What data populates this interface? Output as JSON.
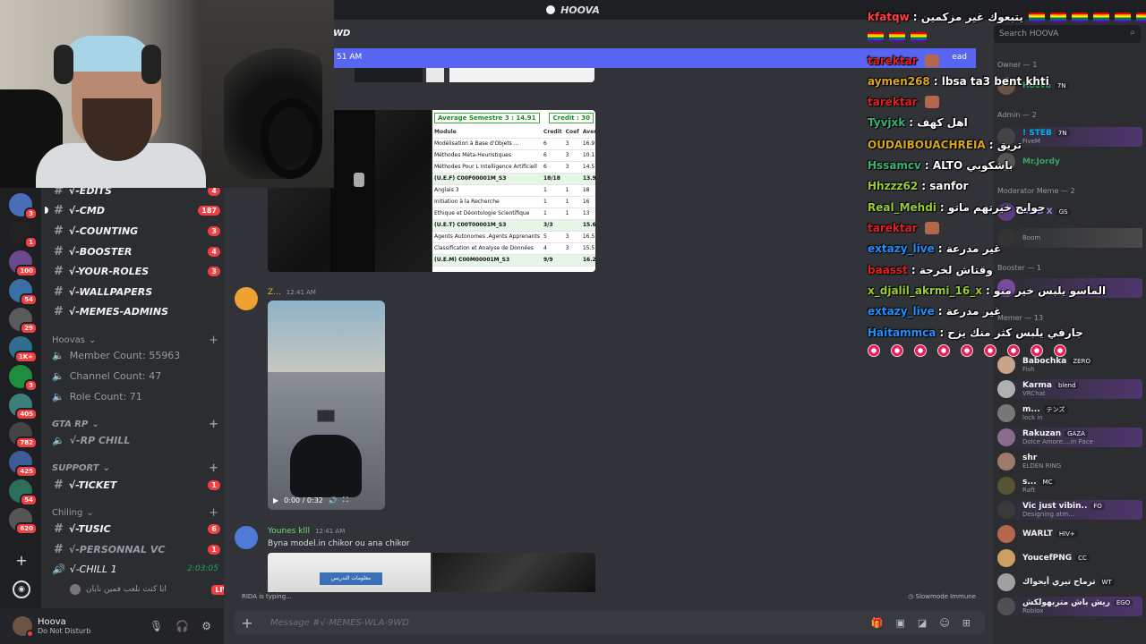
{
  "window": {
    "title": "HOOVA"
  },
  "banner": {
    "time": "51 AM",
    "right": "ead"
  },
  "header": {
    "channel_fragment": "WD"
  },
  "channels": [
    {
      "name": "√-EDITS",
      "badge": "4"
    },
    {
      "name": "√-CMD",
      "badge": "187"
    },
    {
      "name": "√-COUNTING",
      "badge": "3"
    },
    {
      "name": "√-BOOSTER",
      "badge": "4"
    },
    {
      "name": "√-YOUR-ROLES",
      "badge": "3"
    },
    {
      "name": "√-WALLPAPERS",
      "badge": ""
    },
    {
      "name": "√-MEMES-ADMINS",
      "badge": ""
    }
  ],
  "stats": {
    "category": "Hoovas",
    "member_count": "Member Count: 55963",
    "channel_count": "Channel Count: 47",
    "role_count": "Role Count: 71"
  },
  "gtarp": {
    "category": "GTA RP",
    "channel": "√-RP CHILL"
  },
  "support": {
    "category": "SUPPORT",
    "channel": "√-TICKET",
    "badge": "1"
  },
  "chiling": {
    "category": "Chiling",
    "tusic": "√-TUSIC",
    "tusic_badge": "6",
    "personal": "√-PERSONNAL VC",
    "personal_badge": "1",
    "chill": "√-CHILL 1",
    "chill_time": "2:03:05",
    "live_user": "انا كنت نلعب فمين نايان",
    "live": "LIVE"
  },
  "guild_badges": [
    "3",
    "1",
    "100",
    "54",
    "29",
    "1K+",
    "3",
    "405",
    "782",
    "425",
    "54",
    "620"
  ],
  "user": {
    "name": "Hoova",
    "status": "Do Not Disturb"
  },
  "messages": {
    "m1": {
      "author": "Z...",
      "time": "12:41 AM"
    },
    "video": {
      "time": "0:00 / 0:32"
    },
    "m2": {
      "author": "Younes klll",
      "time": "12:41 AM",
      "text": "Byna model.in chikor ou ana chikor"
    },
    "bottom_img_label": "معلومات التدريس"
  },
  "grades": {
    "title": "Average Semestre 3 : 14.91",
    "credit": "Credit : 30",
    "headers": [
      "Module",
      "Credit",
      "Coef",
      "Average"
    ],
    "rows": [
      {
        "name": "Modélisation à Base d'Objets ...",
        "credit": "6",
        "coef": "3",
        "avg": "16.9",
        "g": false
      },
      {
        "name": "Méthodes Méta-Heuristiques",
        "credit": "6",
        "coef": "3",
        "avg": "10.1",
        "g": false
      },
      {
        "name": "Méthodes Pour L Intelligence Artificiell",
        "credit": "6",
        "coef": "3",
        "avg": "14.5",
        "g": false
      },
      {
        "name": "(U.E.F) C00F00001M_S3",
        "credit": "18/18",
        "coef": "",
        "avg": "13.9",
        "g": true
      },
      {
        "name": "Anglais 3",
        "credit": "1",
        "coef": "1",
        "avg": "18",
        "g": false
      },
      {
        "name": "Initiation à la Recherche",
        "credit": "1",
        "coef": "1",
        "avg": "16",
        "g": false
      },
      {
        "name": "Ethique et Déontologie Scientifique",
        "credit": "1",
        "coef": "1",
        "avg": "13",
        "g": false
      },
      {
        "name": "(U.E.T) C00T00001M_S3",
        "credit": "3/3",
        "coef": "",
        "avg": "15.6",
        "g": true
      },
      {
        "name": "Agents Autonomes .Agents Apprenants",
        "credit": "5",
        "coef": "3",
        "avg": "16.5",
        "g": false
      },
      {
        "name": "Classification et Analyse de Données",
        "credit": "4",
        "coef": "3",
        "avg": "15.5",
        "g": false
      },
      {
        "name": "(U.E.M) C00M00001M_S3",
        "credit": "9/9",
        "coef": "",
        "avg": "16.2",
        "g": true
      }
    ]
  },
  "footer": {
    "typing": "RIDA is typing...",
    "typing_user": "RIDA",
    "slowmode": "Slowmode Immune",
    "composer_placeholder": "Message #√-MEMES-WLA-9WD"
  },
  "members": {
    "search_placeholder": "Search HOOVA",
    "groups": {
      "owner": "Owner — 1",
      "admin": "Admin — 2",
      "moderator": "Moderator Meme — 2",
      "booster": "Booster — 1",
      "member": "Memer — 13"
    },
    "owner": [
      {
        "name": "Hoova",
        "tag": "7N",
        "color": "#3ba55d",
        "status": ""
      }
    ],
    "admin": [
      {
        "name": "! STEB",
        "tag": "7N",
        "color": "#00b0f4",
        "status": "FiveM"
      },
      {
        "name": "Mr.Jordy",
        "tag": "",
        "color": "#3ba55d",
        "status": ""
      }
    ],
    "moderator": [
      {
        "name": "IIIeD X",
        "tag": "GS",
        "color": "#9b84ee",
        "status": ""
      },
      {
        "name": "",
        "tag": "",
        "color": "#3ba55d",
        "status": "Boom"
      }
    ],
    "list": [
      {
        "name": "Babochka",
        "tag": "ZERO",
        "color": "#e0e0e0",
        "status": "Fish"
      },
      {
        "name": "Karma",
        "tag": "blend",
        "color": "#e0e0e0",
        "status": "VRChat"
      },
      {
        "name": "m...",
        "tag": "テンズ",
        "color": "#e0e0e0",
        "status": "lock in"
      },
      {
        "name": "Rakuzan",
        "tag": "GAZA",
        "color": "#e0e0e0",
        "status": "Dolce Amore....in Pace"
      },
      {
        "name": "shr",
        "tag": "",
        "color": "#e0e0e0",
        "status": "ELDEN RING"
      },
      {
        "name": "s...",
        "tag": "MC",
        "color": "#e0e0e0",
        "status": "Raft"
      },
      {
        "name": "Vic just vibin..",
        "tag": "FO",
        "color": "#e0e0e0",
        "status": "Designing atm..."
      },
      {
        "name": "WARLT",
        "tag": "HIV+",
        "color": "#e0e0e0",
        "status": ""
      },
      {
        "name": "YoucefPNG",
        "tag": "CC",
        "color": "#e0e0e0",
        "status": ""
      },
      {
        "name": "ترماح تيري أيحواك",
        "tag": "WT",
        "color": "#e0e0e0",
        "status": ""
      },
      {
        "name": "ريش باش متربهولكش",
        "tag": "EGO",
        "color": "#e0e0e0",
        "status": "Roblox"
      }
    ]
  },
  "live_chat": [
    {
      "user": "kfatqw",
      "msg": ": يتبعوك غير مزكمين",
      "color": "#ff4040",
      "emo": "flags"
    },
    {
      "user": "",
      "msg": "",
      "color": "#ffffff",
      "emo": "flags2"
    },
    {
      "user": "tarektar",
      "msg": "",
      "color": "#e02020",
      "emo": "pic"
    },
    {
      "user": "aymen268",
      "msg": ": lbsa ta3 bent khti",
      "color": "#daa520",
      "emo": ""
    },
    {
      "user": "tarektar",
      "msg": "",
      "color": "#e02020",
      "emo": "pic"
    },
    {
      "user": "Tyvjxk",
      "msg": ": اهل كهف",
      "color": "#3cb371",
      "emo": ""
    },
    {
      "user": "OUDAIBOUACHREIA",
      "msg": ": تريق",
      "color": "#daa520",
      "emo": ""
    },
    {
      "user": "Hssamcv",
      "msg": ": ALTO باشكوبي",
      "color": "#3cb371",
      "emo": ""
    },
    {
      "user": "Hhzzz62",
      "msg": ": sanfor",
      "color": "#9acd32",
      "emo": ""
    },
    {
      "user": "Real_Mehdi",
      "msg": ": حوايج خيرتهم ماتو",
      "color": "#9acd32",
      "emo": ""
    },
    {
      "user": "tarektar",
      "msg": "",
      "color": "#e02020",
      "emo": "pic"
    },
    {
      "user": "extazy_live",
      "msg": ": غير مدرعة",
      "color": "#1e90ff",
      "emo": ""
    },
    {
      "user": "baasst",
      "msg": ": وقتاش لخرجة",
      "color": "#e02020",
      "emo": ""
    },
    {
      "user": "x_djalil_akrmi_16_x",
      "msg": ": الماسو يلبس خير منو",
      "color": "#9acd32",
      "emo": ""
    },
    {
      "user": "extazy_live",
      "msg": ": غير مدرعة",
      "color": "#1e90ff",
      "emo": ""
    },
    {
      "user": "Haitammca",
      "msg": ": جارفي يلبس كثر منك يزح",
      "color": "#1e90ff",
      "emo": "hearts"
    }
  ]
}
